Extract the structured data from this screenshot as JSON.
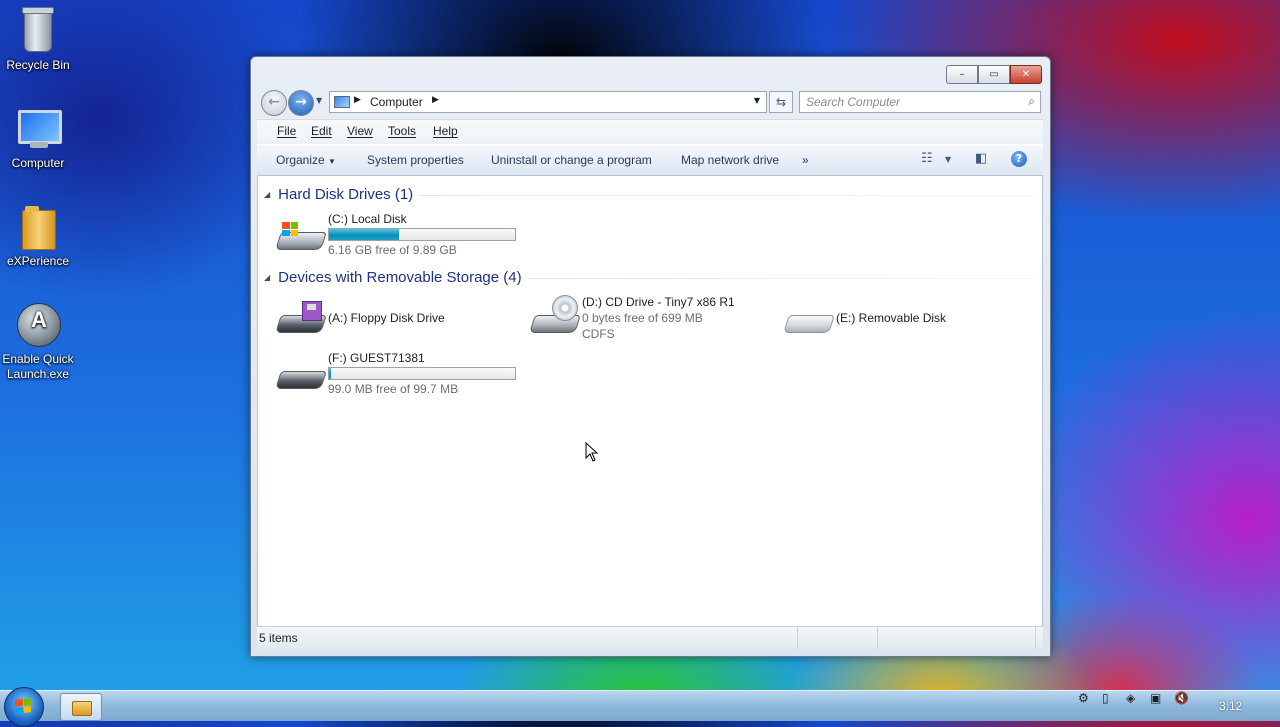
{
  "desktop": {
    "icons": [
      {
        "label": "Recycle Bin",
        "icon": "recycle-bin-icon"
      },
      {
        "label": "Computer",
        "icon": "computer-icon"
      },
      {
        "label": "eXPerience",
        "icon": "folder-icon"
      },
      {
        "label": "Enable Quick Launch.exe",
        "icon": "quick-launch-icon"
      }
    ]
  },
  "window": {
    "caption_buttons": {
      "minimize": "–",
      "maximize": "▭",
      "close": "✕"
    },
    "address": {
      "location": "Computer"
    },
    "search": {
      "placeholder": "Search Computer"
    },
    "menu": [
      "File",
      "Edit",
      "View",
      "Tools",
      "Help"
    ],
    "toolbar": {
      "organize": "Organize",
      "system_properties": "System properties",
      "uninstall": "Uninstall or change a program",
      "map_drive": "Map network drive",
      "more": "»"
    },
    "groups": {
      "hard_disks": {
        "title": "Hard Disk Drives (1)",
        "items": [
          {
            "name": "(C:) Local Disk",
            "detail": "6.16 GB free of 9.89 GB",
            "used_fraction": 0.377
          }
        ]
      },
      "removable": {
        "title": "Devices with Removable Storage (4)",
        "items": [
          {
            "name": "(A:) Floppy Disk Drive"
          },
          {
            "name": "(D:) CD Drive - Tiny7 x86 R1",
            "detail": "0 bytes free of 699 MB",
            "filesystem": "CDFS"
          },
          {
            "name": "(E:) Removable Disk"
          },
          {
            "name": "(F:) GUEST71381",
            "detail": "99.0 MB free of 99.7 MB",
            "used_fraction": 0.007
          }
        ]
      }
    },
    "status": {
      "count": "5 items"
    }
  },
  "taskbar": {
    "clock": "3:12"
  },
  "colors": {
    "group_heading": "#1e3287",
    "capacity_bar": "#1aa2c9",
    "toolbar_text": "#1e395b"
  }
}
